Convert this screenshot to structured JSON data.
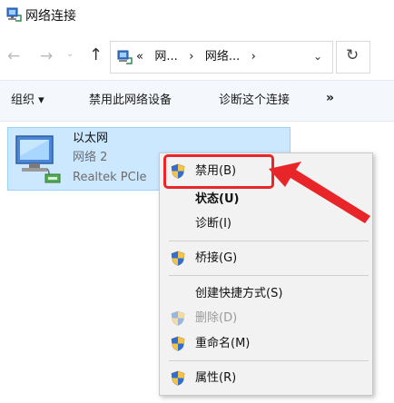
{
  "window": {
    "title": "网络连接"
  },
  "address_bar": {
    "back": "←",
    "forward": "→",
    "history_dropdown": "⌄",
    "up": "↑",
    "path_prefix": "«",
    "segment_1": "网...",
    "separator": "›",
    "segment_2": "网络...",
    "separator_2": "›",
    "dropdown": "⌄",
    "refresh": "↻"
  },
  "toolbar": {
    "organize": "组织 ▾",
    "disable_device": "禁用此网络设备",
    "diagnose": "诊断这个连接",
    "more": "»"
  },
  "network_item": {
    "name": "以太网",
    "status": "网络 2",
    "adapter": "Realtek PCIe"
  },
  "context_menu": {
    "items": [
      {
        "label": "禁用(B)"
      },
      {
        "label": "状态(U)"
      },
      {
        "label": "诊断(I)"
      },
      {
        "label": "桥接(G)"
      },
      {
        "label": "创建快捷方式(S)"
      },
      {
        "label": "删除(D)"
      },
      {
        "label": "重命名(M)"
      },
      {
        "label": "属性(R)"
      }
    ]
  },
  "colors": {
    "annotation_red": "#e8262a",
    "selection_blue": "#cce8ff",
    "menu_bg": "#f2f2f2"
  }
}
